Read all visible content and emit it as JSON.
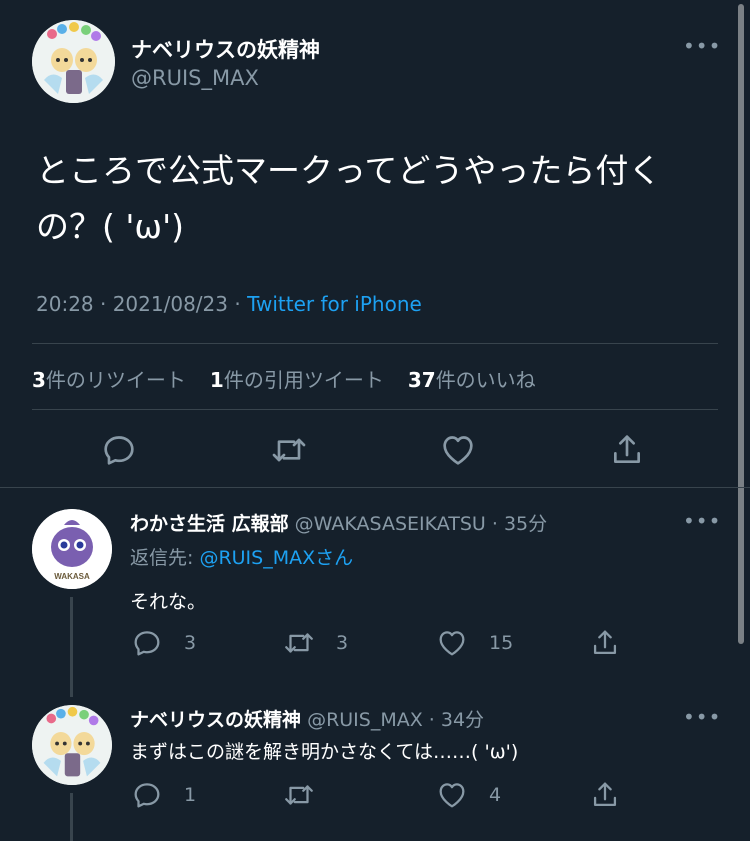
{
  "main_tweet": {
    "display_name": "ナベリウスの妖精神",
    "handle": "@RUIS_MAX",
    "text": "ところで公式マークってどうやったら付くの？( 'ω')",
    "time": "20:28 · 2021/08/23 · ",
    "source": "Twitter for iPhone",
    "stats": {
      "retweets_count": "3",
      "retweets_label": "件のリツイート",
      "quotes_count": "1",
      "quotes_label": "件の引用ツイート",
      "likes_count": "37",
      "likes_label": "件のいいね"
    },
    "more_label": "•••"
  },
  "replies": [
    {
      "display_name": "わかさ生活 広報部",
      "handle": "@WAKASASEIKATSU",
      "time": " · 35分",
      "reply_to_prefix": "返信先: ",
      "reply_to_handle": "@RUIS_MAXさん",
      "text": "それな。",
      "reply_count": "3",
      "retweet_count": "3",
      "like_count": "15",
      "avatar_text": "WAKASA"
    },
    {
      "display_name": "ナベリウスの妖精神",
      "handle": "@RUIS_MAX",
      "time": " · 34分",
      "text": "まずはこの謎を解き明かさなくては……( 'ω')",
      "reply_count": "1",
      "retweet_count": "",
      "like_count": "4"
    }
  ],
  "icons": [
    "more-icon",
    "reply-icon",
    "retweet-icon",
    "like-icon",
    "share-icon"
  ],
  "colors": {
    "background": "#15202b",
    "muted": "#8899a6",
    "link": "#1da1f2",
    "border": "#38444d"
  }
}
